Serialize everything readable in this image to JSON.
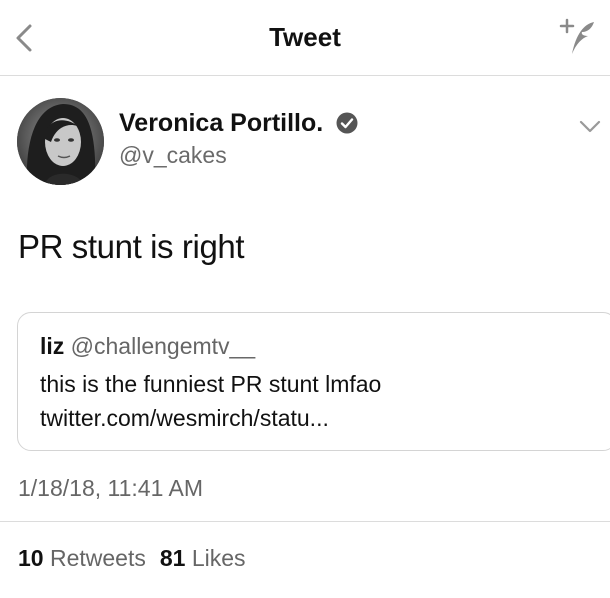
{
  "nav": {
    "title": "Tweet",
    "back_icon": "chevron-left-icon",
    "compose_icon": "compose-feather-icon"
  },
  "tweet": {
    "author": {
      "name": "Veronica Portillo.",
      "handle": "@v_cakes",
      "verified": true
    },
    "text": "PR stunt is right",
    "quoted": {
      "name": "liz",
      "handle": "@challengemtv__",
      "line1": "this is the funniest PR stunt lmfao",
      "line2": "twitter.com/wesmirch/statu..."
    },
    "timestamp": "1/18/18, 11:41 AM",
    "stats": {
      "retweets_count": "10",
      "retweets_label": "Retweets",
      "likes_count": "81",
      "likes_label": "Likes"
    }
  },
  "colors": {
    "text": "#111111",
    "secondary_text": "#666666",
    "divider": "#dcdcdc"
  }
}
